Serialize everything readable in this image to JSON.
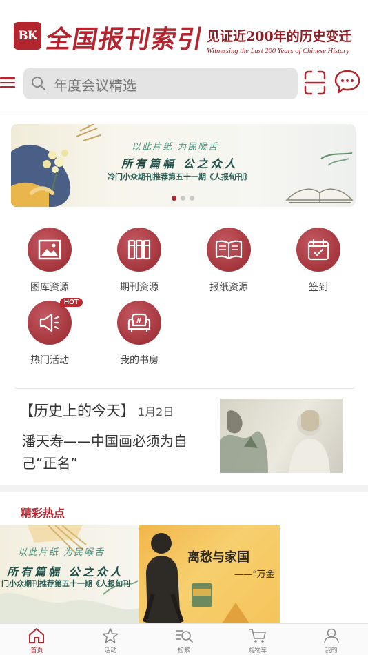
{
  "header": {
    "logo_badge": "BK",
    "logo_title": "全国报刊索引",
    "slogan_main": "见证近200年的历史变迁",
    "slogan_sub": "Witnessing the Last 200 Years of Chinese History"
  },
  "search": {
    "placeholder": "年度会议精选"
  },
  "banner": {
    "line1": "以此片纸  为民喉舌",
    "line2": "所有篇幅  公之众人",
    "line3": "冷门小众期刊推荐第五十一期《人报旬刊》",
    "dots": 3,
    "active_dot": 0
  },
  "features": [
    {
      "label": "图库资源",
      "icon": "image-icon"
    },
    {
      "label": "期刊资源",
      "icon": "journals-icon"
    },
    {
      "label": "报纸资源",
      "icon": "open-book-icon"
    },
    {
      "label": "签到",
      "icon": "calendar-check-icon"
    },
    {
      "label": "热门活动",
      "icon": "megaphone-icon",
      "badge": "HOT"
    },
    {
      "label": "我的书房",
      "icon": "armchair-icon"
    }
  ],
  "history": {
    "title": "【历史上的今天】",
    "date": "1月2日",
    "headline": "潘天寿——中国画必须为自己“正名”"
  },
  "hot_picks": {
    "title": "精彩热点",
    "cards": [
      {
        "line1": "以此片纸  为民喉舌",
        "line2": "所有篇幅  公之众人",
        "line3": "门小众期刊推荐第五十一期《人报旬刊"
      },
      {
        "title": "离愁与家国",
        "subtitle": "——“万金"
      }
    ]
  },
  "bottom_nav": [
    {
      "label": "首页",
      "icon": "home-icon",
      "active": true
    },
    {
      "label": "活动",
      "icon": "star-icon",
      "active": false
    },
    {
      "label": "检索",
      "icon": "search-list-icon",
      "active": false
    },
    {
      "label": "购物车",
      "icon": "cart-icon",
      "active": false
    },
    {
      "label": "我的",
      "icon": "user-icon",
      "active": false
    }
  ],
  "colors": {
    "brand": "#b3262f",
    "icon_circle": "#a2333b",
    "search_bg": "#e4e4e4"
  }
}
